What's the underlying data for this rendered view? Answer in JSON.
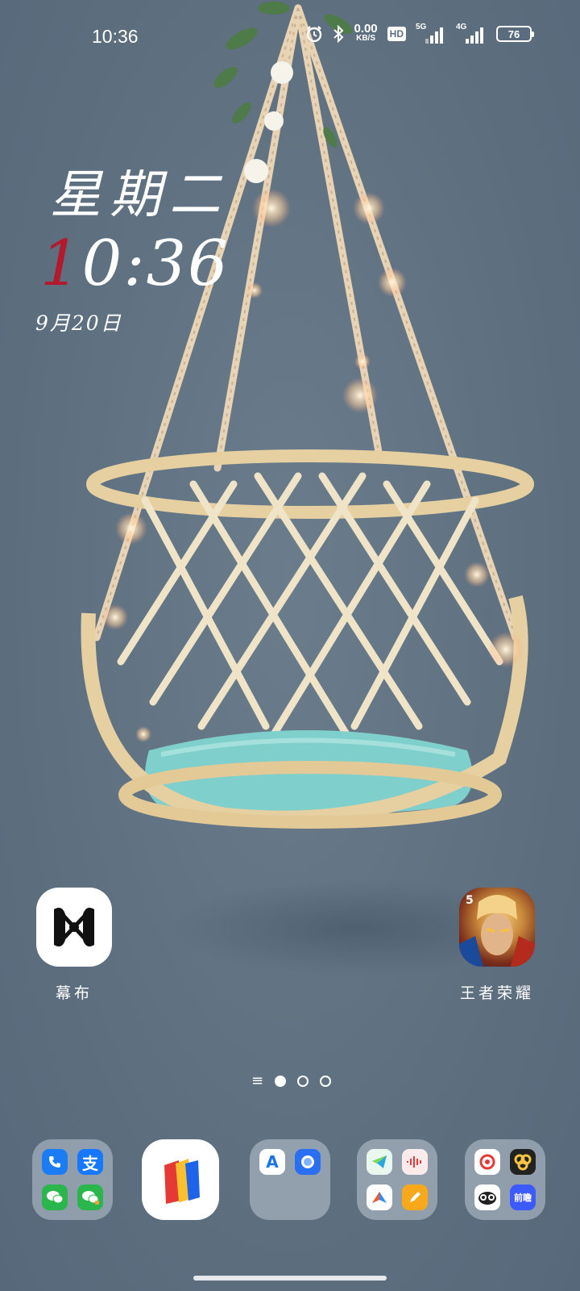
{
  "status_bar": {
    "time": "10:36",
    "net_speed_value": "0.00",
    "net_speed_unit": "KB/S",
    "hd_label": "HD",
    "signal_1_label": "5G",
    "signal_2_label": "4G",
    "battery_level": "76",
    "icons": [
      "alarm-icon",
      "bluetooth-icon"
    ]
  },
  "clock_widget": {
    "weekday": "星期二",
    "time_first_digit": "1",
    "time_rest": "0:36",
    "date": "9月20日",
    "accent_color": "#b4182d"
  },
  "desktop_apps": [
    {
      "label": "幕布",
      "icon": "mubu-icon"
    },
    {
      "label": "王者荣耀",
      "icon": "honor-of-kings-icon"
    }
  ],
  "pager": {
    "menu_icon": "≡",
    "pages": 3,
    "active_index": 0
  },
  "dock": {
    "folder_1": [
      "phone-icon",
      "alipay-icon",
      "wechat-icon",
      "wechat-clone-icon"
    ],
    "alipay_glyph": "支",
    "app_books": "books-app-icon",
    "folder_2": [
      "app-store-icon",
      "browser-icon"
    ],
    "app_store_glyph": "A",
    "folder_3": [
      "telegram-icon",
      "voice-recorder-icon",
      "maps-icon",
      "notes-icon"
    ],
    "folder_4": [
      "music-icon",
      "baidu-netdisk-icon",
      "owl-app-icon",
      "qianwei-icon"
    ],
    "qianwei_glyph": "前瞻"
  }
}
